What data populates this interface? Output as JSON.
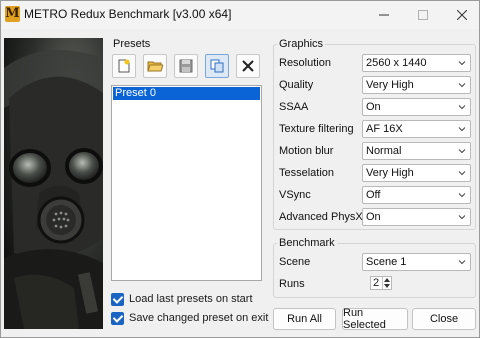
{
  "window": {
    "title": "METRO Redux Benchmark [v3.00 x64]",
    "app_icon_letter": "M"
  },
  "presets": {
    "group_label": "Presets",
    "toolbar": [
      "new-preset-icon",
      "open-folder-icon",
      "save-disk-icon",
      "copy-preset-icon",
      "delete-x-icon"
    ],
    "items": [
      "Preset 0"
    ],
    "selected_index": 0,
    "load_last_label": "Load last presets on start",
    "load_last_checked": true,
    "save_changed_label": "Save changed preset on exit",
    "save_changed_checked": true
  },
  "graphics": {
    "group_label": "Graphics",
    "settings": [
      {
        "label": "Resolution",
        "value": "2560 x 1440"
      },
      {
        "label": "Quality",
        "value": "Very High"
      },
      {
        "label": "SSAA",
        "value": "On"
      },
      {
        "label": "Texture filtering",
        "value": "AF 16X"
      },
      {
        "label": "Motion blur",
        "value": "Normal"
      },
      {
        "label": "Tesselation",
        "value": "Very High"
      },
      {
        "label": "VSync",
        "value": "Off"
      },
      {
        "label": "Advanced PhysX",
        "value": "On"
      }
    ]
  },
  "benchmark": {
    "group_label": "Benchmark",
    "scene_label": "Scene",
    "scene_value": "Scene 1",
    "runs_label": "Runs",
    "runs_value": "2"
  },
  "buttons": {
    "run_all": "Run All",
    "run_selected": "Run Selected",
    "close": "Close"
  },
  "colors": {
    "accent": "#0a64d6",
    "checkbox": "#1a64c4"
  }
}
